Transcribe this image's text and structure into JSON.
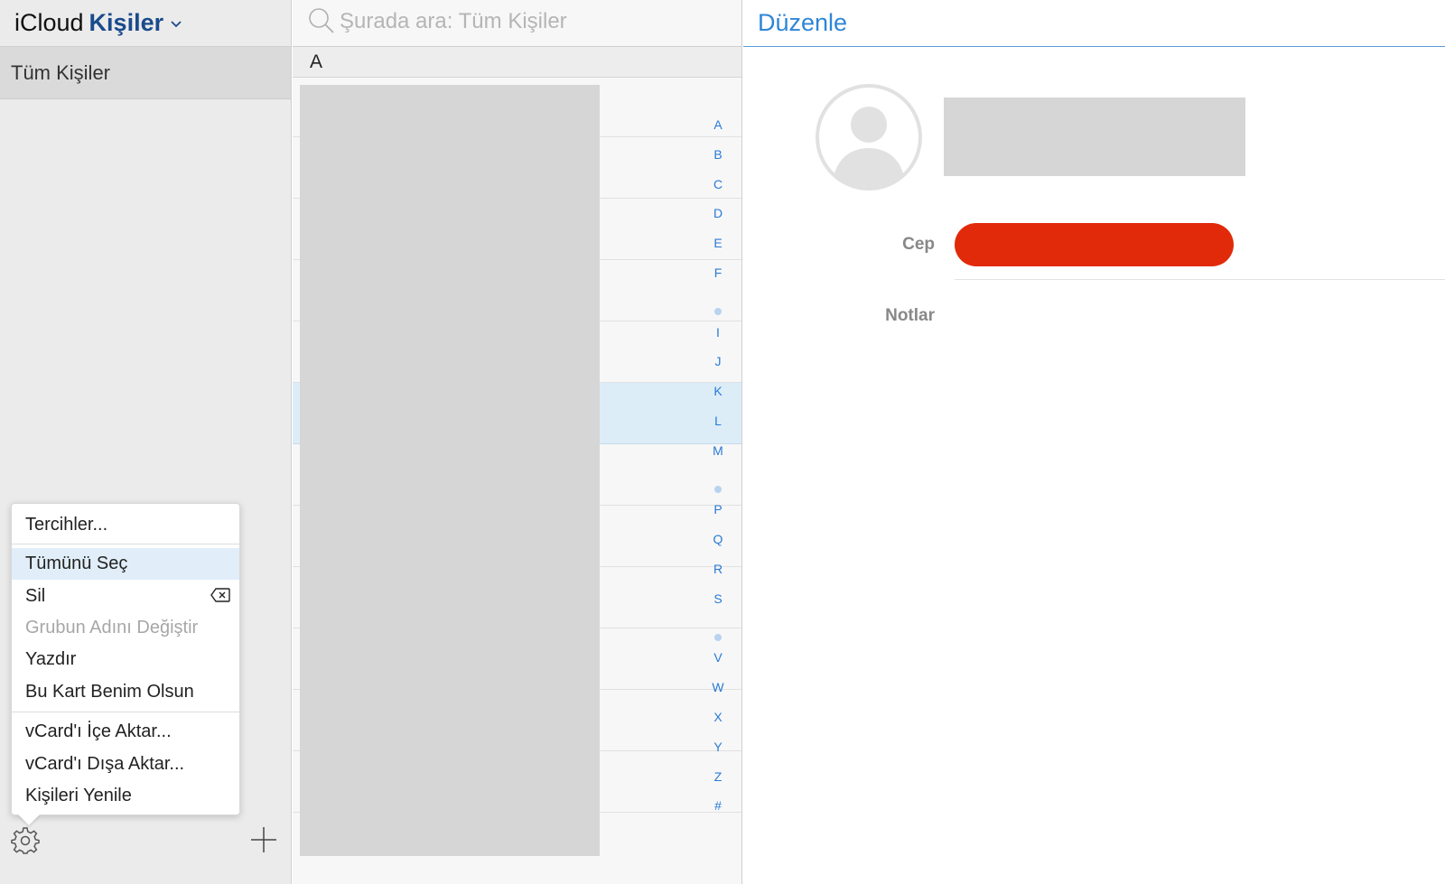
{
  "sidebar": {
    "brand_icloud": "iCloud",
    "brand_app": "Kişiler",
    "groups": [
      {
        "label": "Tüm Kişiler"
      }
    ]
  },
  "menu": {
    "preferences": "Tercihler...",
    "select_all": "Tümünü Seç",
    "delete": "Sil",
    "rename_group": "Grubun Adını Değiştir",
    "print": "Yazdır",
    "make_my_card": "Bu Kart Benim Olsun",
    "import_vcard": "vCard'ı İçe Aktar...",
    "export_vcard": "vCard'ı Dışa Aktar...",
    "refresh": "Kişileri Yenile"
  },
  "list": {
    "search_placeholder": "Şurada ara: Tüm Kişiler",
    "section_header": "A",
    "index_letters": [
      "A",
      "B",
      "C",
      "D",
      "E",
      "F",
      "•",
      "I",
      "J",
      "K",
      "L",
      "M",
      "•",
      "P",
      "Q",
      "R",
      "S",
      "•",
      "V",
      "W",
      "X",
      "Y",
      "Z",
      "#"
    ]
  },
  "detail": {
    "edit_label": "Düzenle",
    "mobile_label": "Cep",
    "notes_label": "Notlar"
  },
  "colors": {
    "accent": "#2f86d6",
    "brand_blue": "#1a4b8c",
    "redaction_red": "#e12a0a",
    "selected_row": "#dcedf8"
  }
}
